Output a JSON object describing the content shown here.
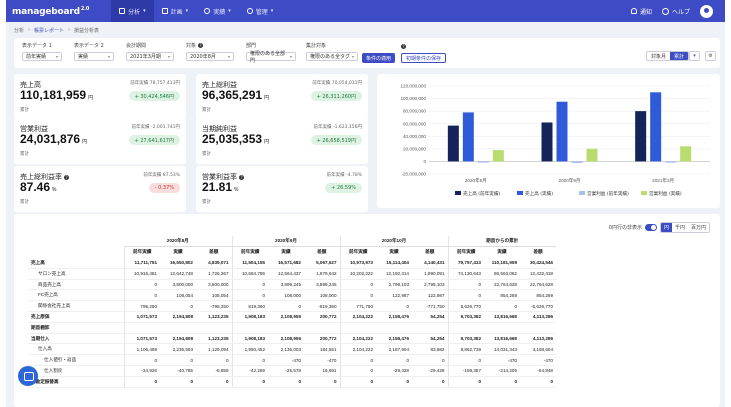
{
  "app": {
    "logo": "manageboard",
    "logo_mark": "2.0",
    "nav": [
      {
        "label": "分析",
        "active": true
      },
      {
        "label": "計画",
        "active": false
      },
      {
        "label": "実績",
        "active": false
      },
      {
        "label": "管理",
        "active": false
      }
    ],
    "notifications": "通知",
    "help": "ヘルプ"
  },
  "breadcrumb": [
    "分析",
    "帳票レポート",
    "損益分析表"
  ],
  "filters": [
    {
      "label": "表示データ 1",
      "value": "前年実績"
    },
    {
      "label": "表示データ 2",
      "value": "実績"
    },
    {
      "label": "会計期間",
      "value": "2021年3月期"
    },
    {
      "label": "対象",
      "value": "2020年8月"
    },
    {
      "label": "部門",
      "value": "権限のある全部門"
    },
    {
      "label": "集計対象",
      "value": "権限のある全タグ"
    }
  ],
  "apply_button": "条件の適用",
  "save_button": "初期条件の保存",
  "period_toggle": [
    "対象月",
    "累計"
  ],
  "kpis": [
    {
      "title": "売上高",
      "prev": "前年実績 78,757,413円",
      "value": "110,181,959",
      "unit": "円",
      "sub": "累計",
      "delta": "+ 30,424,546円",
      "dir": "up"
    },
    {
      "title": "売上総利益",
      "prev": "前年実績 70,054,031円",
      "value": "96,365,291",
      "unit": "円",
      "sub": "累計",
      "delta": "+ 26,311,260円",
      "dir": "up"
    },
    {
      "title": "営業利益",
      "prev": "前年実績 -2,003,741円",
      "value": "24,031,876",
      "unit": "円",
      "sub": "累計",
      "delta": "+ 27,641,617円",
      "dir": "up"
    },
    {
      "title": "当期純利益",
      "prev": "前年実績 -1,623,156円",
      "value": "25,035,353",
      "unit": "円",
      "sub": "累計",
      "delta": "+ 26,658,519円",
      "dir": "up"
    },
    {
      "title": "売上総利益率",
      "prev": "前年実績 87.53%",
      "value": "87.46",
      "unit": "%",
      "sub": "累計",
      "delta": "- 0.37%",
      "dir": "down"
    },
    {
      "title": "営業利益率",
      "prev": "前年実績 -4.78%",
      "value": "21.81",
      "unit": "%",
      "sub": "累計",
      "delta": "+ 26.59%",
      "dir": "up"
    }
  ],
  "chart_data": {
    "type": "bar",
    "categories": [
      "2020年8月",
      "2020年9月",
      "2021年3月"
    ],
    "series": [
      {
        "name": "売上高 (前年実績)",
        "color": "#14245a",
        "values": [
          57000000,
          62000000,
          80000000
        ]
      },
      {
        "name": "売上高 (実績)",
        "color": "#2f5bd8",
        "values": [
          78000000,
          95000000,
          110000000
        ]
      },
      {
        "name": "営業利益 (前年実績)",
        "color": "#a9c0ee",
        "values": [
          -2000000,
          -2500000,
          -2000000
        ]
      },
      {
        "name": "営業利益 (実績)",
        "color": "#b9dc6e",
        "values": [
          18000000,
          20000000,
          24000000
        ]
      }
    ],
    "ylim": [
      -20000000,
      100000000
    ],
    "yticks": [
      "120,000,000",
      "100,000,000",
      "80,000,000",
      "60,000,000",
      "40,000,000",
      "20,000,000",
      "0",
      "-20,000,000"
    ],
    "legend_position": "bottom"
  },
  "table": {
    "tools": {
      "toggle_label": "0円行の非表示",
      "units": [
        "円",
        "千円",
        "百万円"
      ]
    },
    "groups": [
      "2020年8月",
      "2020年9月",
      "2020年10月",
      "期首からの累計"
    ],
    "sub_headers": [
      "前年実績",
      "実績",
      "差額"
    ],
    "rows": [
      {
        "label": "売上高",
        "style": "bold",
        "values": [
          "11,711,751",
          "16,550,802",
          "4,839,071",
          "11,504,155",
          "16,571,682",
          "5,067,527",
          "10,973,973",
          "15,114,404",
          "4,140,431",
          "79,757,413",
          "110,181,959",
          "30,424,546"
        ]
      },
      {
        "label": "サロン売上高",
        "style": "ind1",
        "values": [
          "10,916,481",
          "12,642,748",
          "1,726,267",
          "10,684,795",
          "12,564,437",
          "1,879,642",
          "10,202,222",
          "12,192,314",
          "1,990,091",
          "74,130,643",
          "86,563,062",
          "12,432,419"
        ]
      },
      {
        "label": "商品売上高",
        "style": "ind1",
        "values": [
          "0",
          "3,800,000",
          "3,800,000",
          "0",
          "3,899,245",
          "3,899,245",
          "0",
          "2,799,103",
          "2,799,103",
          "0",
          "22,764,628",
          "22,764,628"
        ]
      },
      {
        "label": "FC売上高",
        "style": "ind1",
        "values": [
          "0",
          "108,054",
          "108,054",
          "0",
          "108,000",
          "108,000",
          "0",
          "122,987",
          "122,987",
          "0",
          "854,269",
          "854,269"
        ]
      },
      {
        "label": "関係会社売上高",
        "style": "ind1",
        "values": [
          "795,250",
          "0",
          "-795,250",
          "819,360",
          "0",
          "-819,360",
          "771,750",
          "0",
          "-771,750",
          "5,626,770",
          "0",
          "-5,626,770"
        ]
      },
      {
        "label": "売上原価",
        "style": "bold",
        "values": [
          "1,071,573",
          "2,194,808",
          "1,123,235",
          "1,908,183",
          "2,108,955",
          "200,772",
          "2,104,222",
          "2,158,476",
          "54,254",
          "9,703,382",
          "13,816,668",
          "4,113,286"
        ]
      },
      {
        "label": "期首棚卸",
        "style": "bold",
        "values": [
          "",
          "",
          "",
          "",
          "",
          "",
          "",
          "",
          "",
          "",
          "",
          ""
        ]
      },
      {
        "label": "当期仕入",
        "style": "bold",
        "values": [
          "1,071,573",
          "2,194,808",
          "1,123,235",
          "1,908,183",
          "2,108,955",
          "200,772",
          "2,104,222",
          "2,158,476",
          "54,254",
          "9,703,382",
          "13,816,668",
          "4,113,286"
        ]
      },
      {
        "label": "仕入高",
        "style": "ind1",
        "values": [
          "1,106,499",
          "2,235,593",
          "1,129,094",
          "1,950,452",
          "2,135,003",
          "184,551",
          "2,104,222",
          "2,187,904",
          "83,682",
          "9,862,739",
          "14,031,343",
          "4,168,604"
        ]
      },
      {
        "label": "仕入値引・返品",
        "style": "ind2",
        "values": [
          "0",
          "0",
          "0",
          "0",
          "-470",
          "-470",
          "0",
          "0",
          "0",
          "0",
          "-470",
          "-470"
        ]
      },
      {
        "label": "仕入割戻",
        "style": "ind2",
        "values": [
          "-34,926",
          "-40,785",
          "-5,859",
          "-42,269",
          "-25,578",
          "16,691",
          "0",
          "-29,428",
          "-29,428",
          "-159,357",
          "-214,205",
          "-54,848"
        ]
      },
      {
        "label": "他勘定振替高",
        "style": "bold",
        "values": [
          "0",
          "0",
          "0",
          "0",
          "0",
          "0",
          "0",
          "0",
          "0",
          "0",
          "0",
          "0"
        ]
      }
    ]
  }
}
